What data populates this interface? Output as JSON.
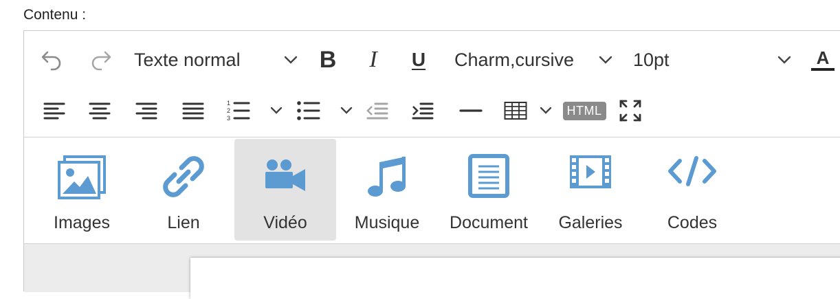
{
  "field": {
    "label": "Contenu :"
  },
  "toolbar": {
    "undo_icon": "undo-icon",
    "redo_icon": "redo-icon",
    "block_format": "Texte normal",
    "bold_label": "B",
    "italic_label": "I",
    "underline_label": "U",
    "font_family": "Charm,cursive",
    "font_size": "10pt",
    "text_color_label": "A",
    "html_label": "HTML"
  },
  "media": {
    "items": [
      {
        "label": "Images",
        "icon": "images-icon"
      },
      {
        "label": "Lien",
        "icon": "link-icon"
      },
      {
        "label": "Vidéo",
        "icon": "video-camera-icon",
        "active": true
      },
      {
        "label": "Musique",
        "icon": "music-note-icon"
      },
      {
        "label": "Document",
        "icon": "document-icon"
      },
      {
        "label": "Galeries",
        "icon": "film-gallery-icon"
      },
      {
        "label": "Codes",
        "icon": "code-icon"
      }
    ]
  },
  "colors": {
    "icon_blue": "#5b9bd1",
    "toolbar_icon": "#333333",
    "disabled_icon": "#9a9a9a",
    "active_bg": "#e3e3e3"
  }
}
